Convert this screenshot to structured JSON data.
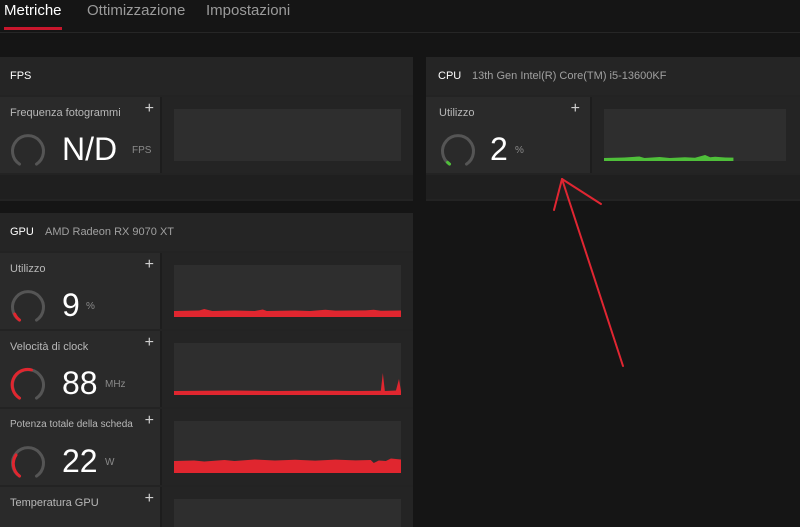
{
  "tabs": [
    {
      "label": "Metriche",
      "active": true
    },
    {
      "label": "Ottimizzazione",
      "active": false
    },
    {
      "label": "Impostazioni",
      "active": false
    }
  ],
  "fps_panel": {
    "title": "FPS",
    "metrics": [
      {
        "label": "Frequenza fotogrammi",
        "value": "N/D",
        "unit": "FPS",
        "gauge_fraction": 0
      }
    ]
  },
  "cpu_panel": {
    "title": "CPU",
    "subtitle": "13th Gen Intel(R) Core(TM) i5-13600KF",
    "metrics": [
      {
        "label": "Utilizzo",
        "value": "2",
        "unit": "%",
        "gauge_fraction": 0.02
      }
    ]
  },
  "gpu_panel": {
    "title": "GPU",
    "subtitle": "AMD Radeon RX 9070 XT",
    "metrics": [
      {
        "label": "Utilizzo",
        "value": "9",
        "unit": "%",
        "gauge_fraction": 0.09
      },
      {
        "label": "Velocità di clock",
        "value": "88",
        "unit": "MHz",
        "gauge_fraction": 0.55
      },
      {
        "label": "Potenza totale della scheda",
        "value": "22",
        "unit": "W",
        "gauge_fraction": 0.4
      },
      {
        "label": "Temperatura GPU",
        "value": "",
        "unit": "",
        "gauge_fraction": 0
      }
    ]
  },
  "colors": {
    "accent": "#c8162c",
    "gpu_series": "#e0262f",
    "cpu_series": "#4fbf3a",
    "gauge_track": "#555555",
    "annotation_arrow": "#e02632"
  },
  "icons": {
    "add": "plus-icon"
  },
  "add_symbol": "+"
}
